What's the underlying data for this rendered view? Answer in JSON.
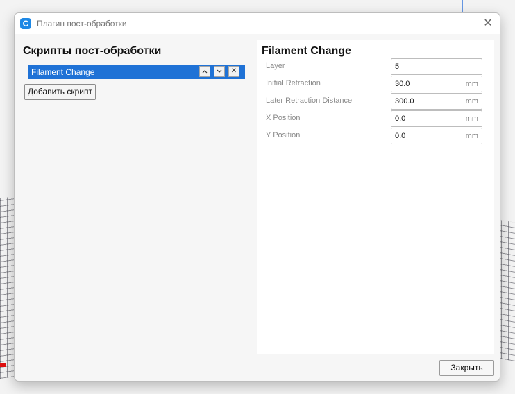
{
  "window": {
    "title": "Плагин пост-обработки"
  },
  "left": {
    "heading": "Скрипты пост-обработки",
    "scripts": [
      {
        "label": "Filament Change",
        "selected": true
      }
    ],
    "add_button": "Добавить скрипт"
  },
  "right": {
    "heading": "Filament Change",
    "fields": [
      {
        "label": "Layer",
        "value": "5",
        "unit": ""
      },
      {
        "label": "Initial Retraction",
        "value": "30.0",
        "unit": "mm"
      },
      {
        "label": "Later Retraction Distance",
        "value": "300.0",
        "unit": "mm"
      },
      {
        "label": "X Position",
        "value": "0.0",
        "unit": "mm"
      },
      {
        "label": "Y Position",
        "value": "0.0",
        "unit": "mm"
      }
    ]
  },
  "footer": {
    "close_button": "Закрыть"
  },
  "icons": {
    "app": "cura-logo-icon",
    "close": "close-icon",
    "move_up": "chevron-up-icon",
    "move_down": "chevron-down-icon",
    "remove": "remove-icon"
  },
  "colors": {
    "accent": "#1f72d6"
  }
}
